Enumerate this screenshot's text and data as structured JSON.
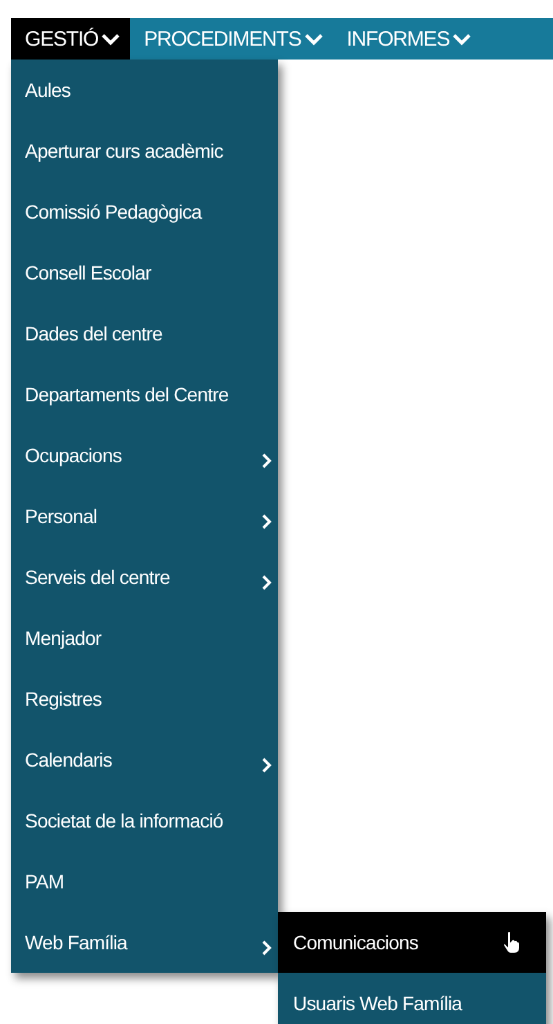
{
  "nav": {
    "tabs": [
      {
        "label": "GESTIÓ",
        "selected": true
      },
      {
        "label": "PROCEDIMENTS",
        "selected": false
      },
      {
        "label": "INFORMES",
        "selected": false
      }
    ]
  },
  "menu": {
    "items": [
      {
        "label": "Aules",
        "has_submenu": false
      },
      {
        "label": "Aperturar curs acadèmic",
        "has_submenu": false
      },
      {
        "label": "Comissió Pedagògica",
        "has_submenu": false
      },
      {
        "label": "Consell Escolar",
        "has_submenu": false
      },
      {
        "label": "Dades del centre",
        "has_submenu": false
      },
      {
        "label": "Departaments del Centre",
        "has_submenu": false
      },
      {
        "label": "Ocupacions",
        "has_submenu": true
      },
      {
        "label": "Personal",
        "has_submenu": true
      },
      {
        "label": "Serveis del centre",
        "has_submenu": true
      },
      {
        "label": "Menjador",
        "has_submenu": false
      },
      {
        "label": "Registres",
        "has_submenu": false
      },
      {
        "label": "Calendaris",
        "has_submenu": true
      },
      {
        "label": "Societat de la informació",
        "has_submenu": false
      },
      {
        "label": "PAM",
        "has_submenu": false
      },
      {
        "label": "Web Família",
        "has_submenu": true,
        "expanded": true,
        "children": [
          {
            "label": "Comunicacions",
            "selected": true
          },
          {
            "label": "Usuaris Web Família",
            "selected": false
          }
        ]
      }
    ]
  }
}
